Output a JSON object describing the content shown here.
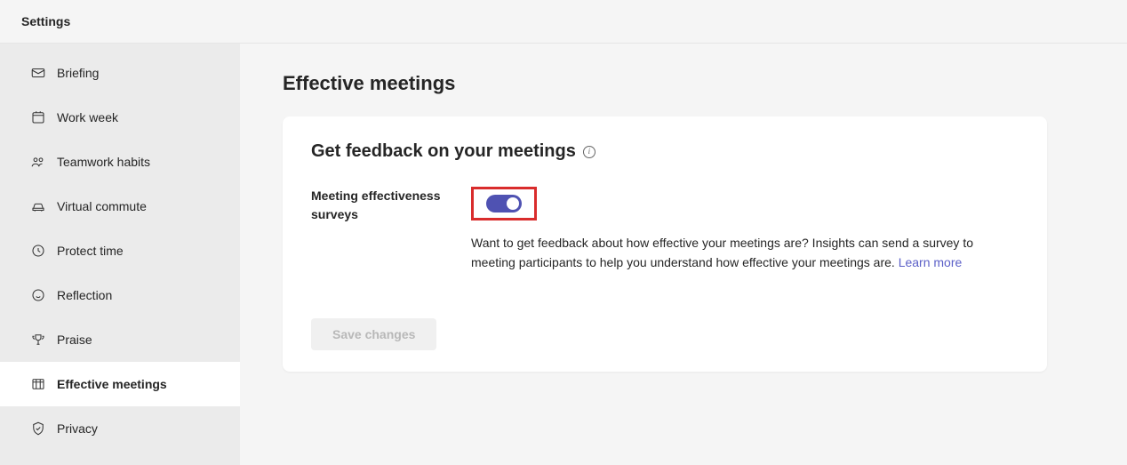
{
  "header": {
    "title": "Settings"
  },
  "sidebar": {
    "items": [
      {
        "label": "Briefing",
        "icon": "mail"
      },
      {
        "label": "Work week",
        "icon": "calendar"
      },
      {
        "label": "Teamwork habits",
        "icon": "people"
      },
      {
        "label": "Virtual commute",
        "icon": "car"
      },
      {
        "label": "Protect time",
        "icon": "clock"
      },
      {
        "label": "Reflection",
        "icon": "smiley"
      },
      {
        "label": "Praise",
        "icon": "trophy"
      },
      {
        "label": "Effective meetings",
        "icon": "grid",
        "active": true
      },
      {
        "label": "Privacy",
        "icon": "shield"
      }
    ]
  },
  "main": {
    "page_title": "Effective meetings",
    "card": {
      "title": "Get feedback on your meetings",
      "setting": {
        "label": "Meeting effectiveness surveys",
        "toggle_on": true,
        "description": "Want to get feedback about how effective your meetings are? Insights can send a survey to meeting participants to help you understand how effective your meetings are. ",
        "learn_more": "Learn more"
      },
      "save_label": "Save changes"
    }
  },
  "annotation": {
    "highlight_toggle": true,
    "highlight_color": "#d92c2c"
  }
}
